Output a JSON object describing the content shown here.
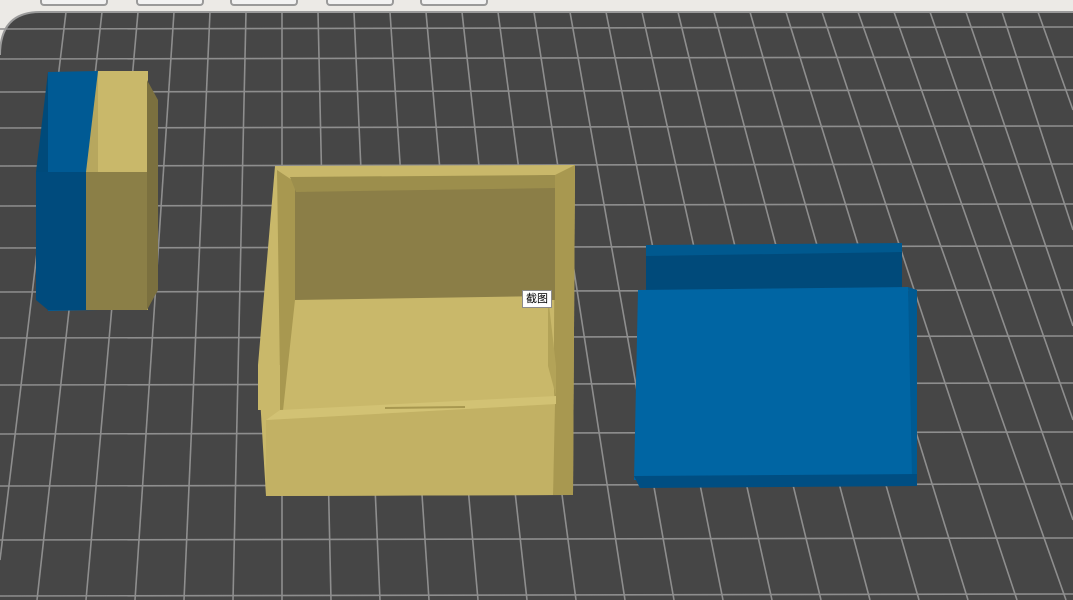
{
  "tooltip": {
    "text": "截图"
  },
  "colors": {
    "bed": "#464646",
    "grid": "#8e8e8e",
    "accent_gold": "#c9b86a",
    "accent_blue": "#0065a3"
  },
  "toolbar": {
    "buttons": [
      "move-tool",
      "scale-tool",
      "mirror-tool",
      "support-tool",
      "rotate-tool"
    ]
  },
  "objects": [
    {
      "name": "two-color-block"
    },
    {
      "name": "gold-box"
    },
    {
      "name": "blue-bed"
    }
  ]
}
